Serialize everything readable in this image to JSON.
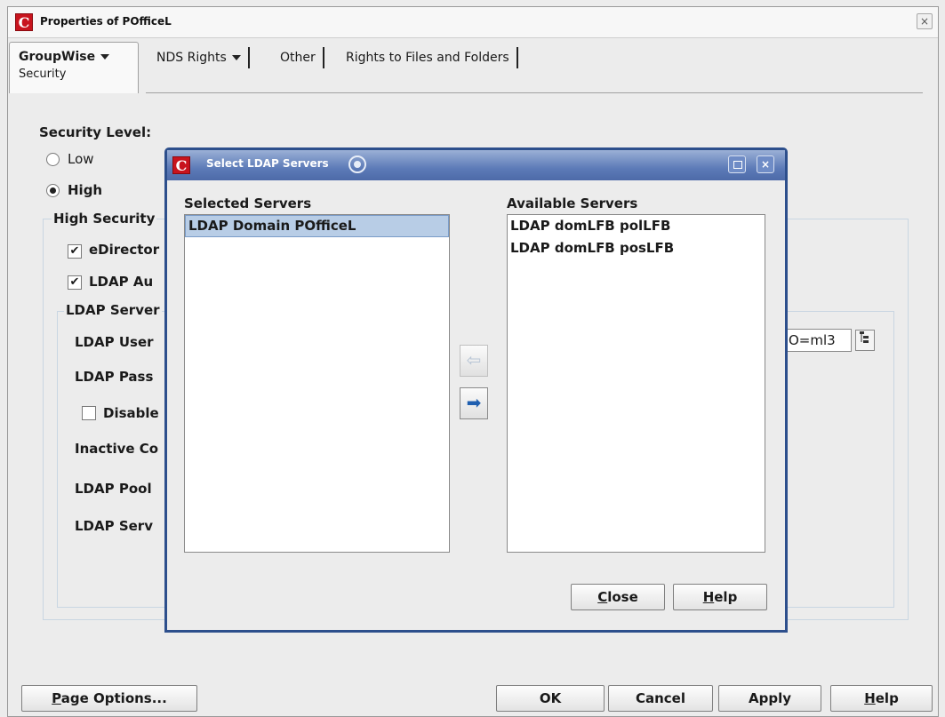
{
  "window": {
    "title": "Properties of POfficeL",
    "close_glyph": "×",
    "logo": "C"
  },
  "tabs": {
    "active": {
      "label": "GroupWise",
      "sub": "Security"
    },
    "nds_rights": "NDS Rights",
    "other": "Other",
    "rights_files": "Rights to Files and Folders"
  },
  "security": {
    "level_label": "Security Level:",
    "low_label": "Low",
    "high_label": "High",
    "selected": "High",
    "high_group_label": "High Security",
    "edirectory_label": "eDirector",
    "edirectory_checked": true,
    "ldap_auth_label": "LDAP Au",
    "ldap_auth_checked": true,
    "ldap_servers_group": "LDAP Server",
    "ldap_user_label": "LDAP User",
    "ldap_user_value": "O=ml3",
    "ldap_pass_label": "LDAP Pass",
    "disable_label": "Disable",
    "disable_checked": false,
    "inactive_label": "Inactive Co",
    "pool_label": "LDAP Pool",
    "server_label": "LDAP Serv"
  },
  "dialog": {
    "title": "Select LDAP Servers",
    "close_glyph": "×",
    "logo": "C",
    "selected_header": "Selected Servers",
    "available_header": "Available Servers",
    "selected_items": [
      "LDAP Domain POfficeL"
    ],
    "available_items": [
      "LDAP domLFB polLFB",
      "LDAP domLFB posLFB"
    ],
    "left_arrow": "⇦",
    "right_arrow": "➡",
    "close_button": {
      "underlined": "C",
      "rest": "lose"
    },
    "help_button": {
      "underlined": "H",
      "rest": "elp"
    }
  },
  "footer": {
    "page_options": {
      "underlined": "P",
      "rest": "age Options..."
    },
    "ok": "OK",
    "cancel": "Cancel",
    "apply": "Apply",
    "help": {
      "underlined": "H",
      "rest": "elp"
    }
  },
  "icons": {
    "browse": "browse-tree-icon"
  }
}
